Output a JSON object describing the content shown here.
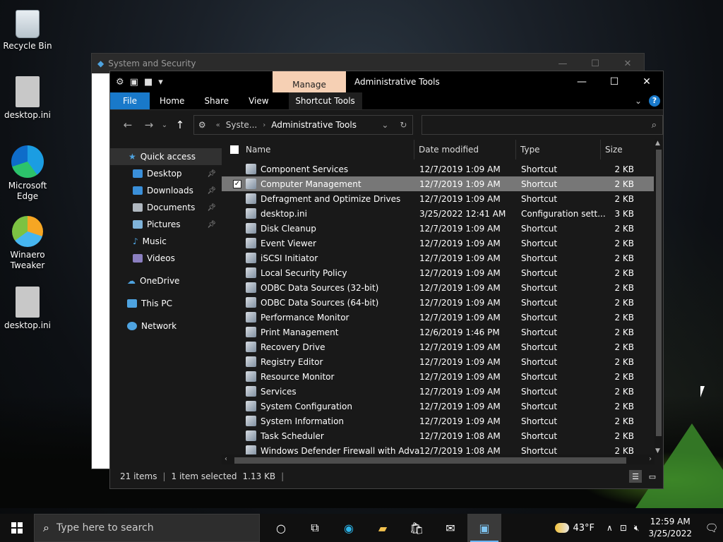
{
  "desktop": {
    "icons": [
      {
        "label": "Recycle Bin",
        "icon": "recycle-bin-icon"
      },
      {
        "label": "desktop.ini",
        "icon": "settings-file-icon"
      },
      {
        "label": "Microsoft Edge",
        "icon": "edge-icon"
      },
      {
        "label": "Winaero Tweaker",
        "icon": "winaero-icon"
      },
      {
        "label": "desktop.ini",
        "icon": "settings-file-icon"
      }
    ]
  },
  "background_window": {
    "title": "System and Security"
  },
  "explorer": {
    "manage_tab": "Manage",
    "title": "Administrative Tools",
    "ribbon_tabs": [
      "File",
      "Home",
      "Share",
      "View",
      "Shortcut Tools"
    ],
    "address": {
      "crumb1": "Syste...",
      "crumb2": "Administrative Tools"
    },
    "search_placeholder": "",
    "nav": {
      "quick_access": "Quick access",
      "quick_items": [
        "Desktop",
        "Downloads",
        "Documents",
        "Pictures",
        "Music",
        "Videos"
      ],
      "onedrive": "OneDrive",
      "this_pc": "This PC",
      "network": "Network"
    },
    "columns": {
      "name": "Name",
      "date": "Date modified",
      "type": "Type",
      "size": "Size"
    },
    "files": [
      {
        "name": "Component Services",
        "date": "12/7/2019 1:09 AM",
        "type": "Shortcut",
        "size": "2 KB",
        "selected": false
      },
      {
        "name": "Computer Management",
        "date": "12/7/2019 1:09 AM",
        "type": "Shortcut",
        "size": "2 KB",
        "selected": true
      },
      {
        "name": "Defragment and Optimize Drives",
        "date": "12/7/2019 1:09 AM",
        "type": "Shortcut",
        "size": "2 KB",
        "selected": false
      },
      {
        "name": "desktop.ini",
        "date": "3/25/2022 12:41 AM",
        "type": "Configuration sett...",
        "size": "3 KB",
        "selected": false
      },
      {
        "name": "Disk Cleanup",
        "date": "12/7/2019 1:09 AM",
        "type": "Shortcut",
        "size": "2 KB",
        "selected": false
      },
      {
        "name": "Event Viewer",
        "date": "12/7/2019 1:09 AM",
        "type": "Shortcut",
        "size": "2 KB",
        "selected": false
      },
      {
        "name": "iSCSI Initiator",
        "date": "12/7/2019 1:09 AM",
        "type": "Shortcut",
        "size": "2 KB",
        "selected": false
      },
      {
        "name": "Local Security Policy",
        "date": "12/7/2019 1:09 AM",
        "type": "Shortcut",
        "size": "2 KB",
        "selected": false
      },
      {
        "name": "ODBC Data Sources (32-bit)",
        "date": "12/7/2019 1:09 AM",
        "type": "Shortcut",
        "size": "2 KB",
        "selected": false
      },
      {
        "name": "ODBC Data Sources (64-bit)",
        "date": "12/7/2019 1:09 AM",
        "type": "Shortcut",
        "size": "2 KB",
        "selected": false
      },
      {
        "name": "Performance Monitor",
        "date": "12/7/2019 1:09 AM",
        "type": "Shortcut",
        "size": "2 KB",
        "selected": false
      },
      {
        "name": "Print Management",
        "date": "12/6/2019 1:46 PM",
        "type": "Shortcut",
        "size": "2 KB",
        "selected": false
      },
      {
        "name": "Recovery Drive",
        "date": "12/7/2019 1:09 AM",
        "type": "Shortcut",
        "size": "2 KB",
        "selected": false
      },
      {
        "name": "Registry Editor",
        "date": "12/7/2019 1:09 AM",
        "type": "Shortcut",
        "size": "2 KB",
        "selected": false
      },
      {
        "name": "Resource Monitor",
        "date": "12/7/2019 1:09 AM",
        "type": "Shortcut",
        "size": "2 KB",
        "selected": false
      },
      {
        "name": "Services",
        "date": "12/7/2019 1:09 AM",
        "type": "Shortcut",
        "size": "2 KB",
        "selected": false
      },
      {
        "name": "System Configuration",
        "date": "12/7/2019 1:09 AM",
        "type": "Shortcut",
        "size": "2 KB",
        "selected": false
      },
      {
        "name": "System Information",
        "date": "12/7/2019 1:09 AM",
        "type": "Shortcut",
        "size": "2 KB",
        "selected": false
      },
      {
        "name": "Task Scheduler",
        "date": "12/7/2019 1:08 AM",
        "type": "Shortcut",
        "size": "2 KB",
        "selected": false
      },
      {
        "name": "Windows Defender Firewall with Adva...",
        "date": "12/7/2019 1:08 AM",
        "type": "Shortcut",
        "size": "2 KB",
        "selected": false
      }
    ],
    "status": {
      "items": "21 items",
      "selected": "1 item selected",
      "size": "1.13 KB"
    }
  },
  "taskbar": {
    "search_placeholder": "Type here to search",
    "weather_temp": "43°F",
    "time": "12:59 AM",
    "date": "3/25/2022"
  },
  "colors": {
    "accent": "#1979ca",
    "manage_tab": "#f6d0b4",
    "selection": "#777777"
  }
}
